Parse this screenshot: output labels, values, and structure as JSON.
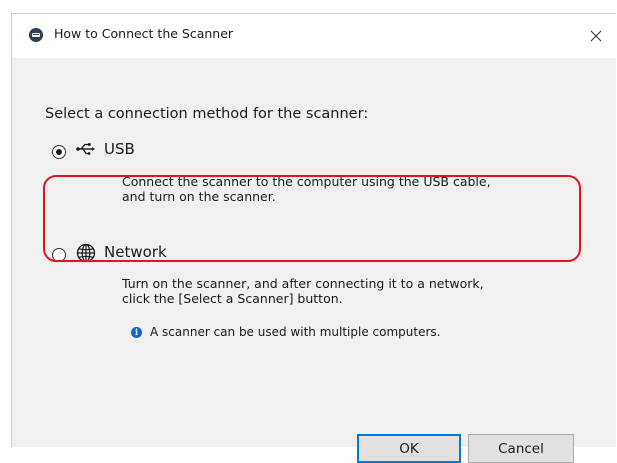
{
  "window": {
    "title": "How to Connect the Scanner",
    "close_glyph": "✕"
  },
  "prompt": "Select a connection method for the scanner:",
  "options": [
    {
      "icon": "usb-icon",
      "label": "USB",
      "selected": true,
      "description": [
        "Connect the scanner to the computer using the USB cable,",
        "and turn on the scanner."
      ]
    },
    {
      "icon": "globe-icon",
      "label": "Network",
      "selected": false,
      "description": [
        "Turn on the scanner, and after connecting it to a network,",
        "click the [Select a Scanner] button."
      ],
      "note": {
        "icon": "info-icon",
        "text": "A scanner can be used with multiple computers."
      }
    }
  ],
  "buttons": {
    "ok": "OK",
    "cancel": "Cancel"
  },
  "colors": {
    "highlight": "#e3141f",
    "dialog_bg": "#f0f0f0",
    "focus_border": "#0078d7",
    "info_blue": "#1a63c7"
  }
}
